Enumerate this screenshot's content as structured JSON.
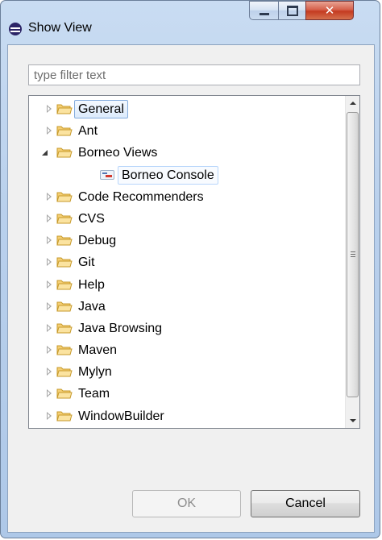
{
  "window": {
    "title": "Show View"
  },
  "filter": {
    "placeholder": "type filter text",
    "value": ""
  },
  "tree": {
    "items": [
      {
        "label": "General",
        "level": 0,
        "state": "collapsed",
        "icon": "folder-icon",
        "selected": true
      },
      {
        "label": "Ant",
        "level": 0,
        "state": "collapsed",
        "icon": "folder-icon"
      },
      {
        "label": "Borneo Views",
        "level": 0,
        "state": "expanded",
        "icon": "folder-icon"
      },
      {
        "label": "Borneo Console",
        "level": 1,
        "state": "leaf",
        "icon": "view-icon",
        "hovered": true
      },
      {
        "label": "Code Recommenders",
        "level": 0,
        "state": "collapsed",
        "icon": "folder-icon"
      },
      {
        "label": "CVS",
        "level": 0,
        "state": "collapsed",
        "icon": "folder-icon"
      },
      {
        "label": "Debug",
        "level": 0,
        "state": "collapsed",
        "icon": "folder-icon"
      },
      {
        "label": "Git",
        "level": 0,
        "state": "collapsed",
        "icon": "folder-icon"
      },
      {
        "label": "Help",
        "level": 0,
        "state": "collapsed",
        "icon": "folder-icon"
      },
      {
        "label": "Java",
        "level": 0,
        "state": "collapsed",
        "icon": "folder-icon"
      },
      {
        "label": "Java Browsing",
        "level": 0,
        "state": "collapsed",
        "icon": "folder-icon"
      },
      {
        "label": "Maven",
        "level": 0,
        "state": "collapsed",
        "icon": "folder-icon"
      },
      {
        "label": "Mylyn",
        "level": 0,
        "state": "collapsed",
        "icon": "folder-icon"
      },
      {
        "label": "Team",
        "level": 0,
        "state": "collapsed",
        "icon": "folder-icon"
      },
      {
        "label": "WindowBuilder",
        "level": 0,
        "state": "collapsed",
        "icon": "folder-icon"
      }
    ]
  },
  "buttons": {
    "ok": "OK",
    "cancel": "Cancel",
    "ok_enabled": false
  },
  "colors": {
    "folder_fill": "#f5cf74",
    "folder_stroke": "#c79a2a",
    "selection_border": "#84acdd"
  }
}
